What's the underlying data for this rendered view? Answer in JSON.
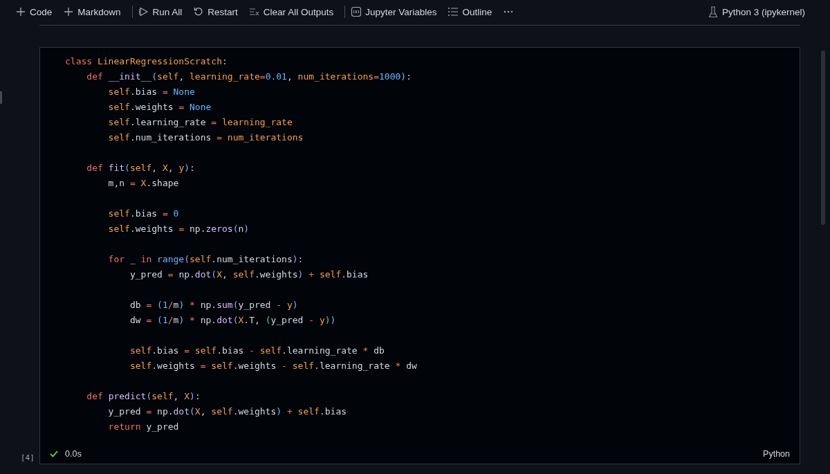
{
  "toolbar": {
    "items": [
      {
        "kind": "plus",
        "label": "Code"
      },
      {
        "kind": "plus",
        "label": "Markdown"
      },
      {
        "kind": "separator"
      },
      {
        "kind": "run",
        "label": "Run All"
      },
      {
        "kind": "restart",
        "label": "Restart"
      },
      {
        "kind": "clear",
        "label": "Clear All Outputs"
      },
      {
        "kind": "separator"
      },
      {
        "kind": "variables",
        "label": "Jupyter Variables"
      },
      {
        "kind": "outline",
        "label": "Outline"
      },
      {
        "kind": "more"
      }
    ],
    "kernel": {
      "label": "Python 3 (ipykernel)"
    }
  },
  "cell": {
    "execution_count": "[4]",
    "status": {
      "success": true,
      "duration": "0.0s"
    },
    "language": "Python",
    "lines": [
      {
        "tokens": [
          {
            "kind": "kw",
            "text": "class "
          },
          {
            "kind": "cls",
            "text": "LinearRegressionScratch"
          },
          {
            "kind": "plain",
            "text": ":"
          }
        ]
      },
      {
        "tokens": [
          {
            "kind": "kw",
            "text": "    def "
          },
          {
            "kind": "fn",
            "text": "__init__"
          },
          {
            "kind": "paren",
            "text": "("
          },
          {
            "kind": "self",
            "text": "self"
          },
          {
            "kind": "plain",
            "text": ", "
          },
          {
            "kind": "param",
            "text": "learning_rate"
          },
          {
            "kind": "op",
            "text": "="
          },
          {
            "kind": "num",
            "text": "0.01"
          },
          {
            "kind": "plain",
            "text": ", "
          },
          {
            "kind": "param",
            "text": "num_iterations"
          },
          {
            "kind": "op",
            "text": "="
          },
          {
            "kind": "num",
            "text": "1000"
          },
          {
            "kind": "paren",
            "text": ")"
          },
          {
            "kind": "plain",
            "text": ":"
          }
        ]
      },
      {
        "tokens": [
          {
            "kind": "self",
            "text": "        self"
          },
          {
            "kind": "plain",
            "text": ".bias "
          },
          {
            "kind": "op",
            "text": "= "
          },
          {
            "kind": "num",
            "text": "None"
          }
        ]
      },
      {
        "tokens": [
          {
            "kind": "self",
            "text": "        self"
          },
          {
            "kind": "plain",
            "text": ".weights "
          },
          {
            "kind": "op",
            "text": "= "
          },
          {
            "kind": "num",
            "text": "None"
          }
        ]
      },
      {
        "tokens": [
          {
            "kind": "self",
            "text": "        self"
          },
          {
            "kind": "plain",
            "text": ".learning_rate "
          },
          {
            "kind": "op",
            "text": "= "
          },
          {
            "kind": "param",
            "text": "learning_rate"
          }
        ]
      },
      {
        "tokens": [
          {
            "kind": "self",
            "text": "        self"
          },
          {
            "kind": "plain",
            "text": ".num_iterations "
          },
          {
            "kind": "op",
            "text": "= "
          },
          {
            "kind": "param",
            "text": "num_iterations"
          }
        ]
      },
      {
        "kind": "blank"
      },
      {
        "tokens": [
          {
            "kind": "kw",
            "text": "    def "
          },
          {
            "kind": "fn",
            "text": "fit"
          },
          {
            "kind": "paren",
            "text": "("
          },
          {
            "kind": "self",
            "text": "self"
          },
          {
            "kind": "plain",
            "text": ", "
          },
          {
            "kind": "param",
            "text": "X"
          },
          {
            "kind": "plain",
            "text": ", "
          },
          {
            "kind": "param",
            "text": "y"
          },
          {
            "kind": "paren",
            "text": ")"
          },
          {
            "kind": "plain",
            "text": ":"
          }
        ]
      },
      {
        "tokens": [
          {
            "kind": "plain",
            "text": "        m,n "
          },
          {
            "kind": "op",
            "text": "= "
          },
          {
            "kind": "param",
            "text": "X"
          },
          {
            "kind": "plain",
            "text": ".shape"
          }
        ]
      },
      {
        "kind": "blank"
      },
      {
        "tokens": [
          {
            "kind": "self",
            "text": "        self"
          },
          {
            "kind": "plain",
            "text": ".bias "
          },
          {
            "kind": "op",
            "text": "= "
          },
          {
            "kind": "num",
            "text": "0"
          }
        ]
      },
      {
        "tokens": [
          {
            "kind": "self",
            "text": "        self"
          },
          {
            "kind": "plain",
            "text": ".weights "
          },
          {
            "kind": "op",
            "text": "= "
          },
          {
            "kind": "plain",
            "text": "np."
          },
          {
            "kind": "fn",
            "text": "zeros"
          },
          {
            "kind": "paren",
            "text": "("
          },
          {
            "kind": "plain",
            "text": "n"
          },
          {
            "kind": "paren",
            "text": ")"
          }
        ]
      },
      {
        "kind": "blank"
      },
      {
        "tokens": [
          {
            "kind": "kw",
            "text": "        for "
          },
          {
            "kind": "plain",
            "text": "_ "
          },
          {
            "kind": "kw",
            "text": "in "
          },
          {
            "kind": "builtin",
            "text": "range"
          },
          {
            "kind": "paren",
            "text": "("
          },
          {
            "kind": "self",
            "text": "self"
          },
          {
            "kind": "plain",
            "text": ".num_iterations"
          },
          {
            "kind": "paren",
            "text": ")"
          },
          {
            "kind": "plain",
            "text": ":"
          }
        ]
      },
      {
        "tokens": [
          {
            "kind": "plain",
            "text": "            y_pred "
          },
          {
            "kind": "op",
            "text": "= "
          },
          {
            "kind": "plain",
            "text": "np."
          },
          {
            "kind": "fn",
            "text": "dot"
          },
          {
            "kind": "paren",
            "text": "("
          },
          {
            "kind": "param",
            "text": "X"
          },
          {
            "kind": "plain",
            "text": ", "
          },
          {
            "kind": "self",
            "text": "self"
          },
          {
            "kind": "plain",
            "text": ".weights"
          },
          {
            "kind": "paren",
            "text": ") "
          },
          {
            "kind": "op",
            "text": "+ "
          },
          {
            "kind": "self",
            "text": "self"
          },
          {
            "kind": "plain",
            "text": ".bias"
          }
        ]
      },
      {
        "kind": "blank"
      },
      {
        "tokens": [
          {
            "kind": "plain",
            "text": "            db "
          },
          {
            "kind": "op",
            "text": "= "
          },
          {
            "kind": "paren",
            "text": "("
          },
          {
            "kind": "num",
            "text": "1"
          },
          {
            "kind": "op",
            "text": "/"
          },
          {
            "kind": "plain",
            "text": "m"
          },
          {
            "kind": "paren",
            "text": ") "
          },
          {
            "kind": "op",
            "text": "* "
          },
          {
            "kind": "plain",
            "text": "np."
          },
          {
            "kind": "fn",
            "text": "sum"
          },
          {
            "kind": "paren",
            "text": "("
          },
          {
            "kind": "plain",
            "text": "y_pred "
          },
          {
            "kind": "op",
            "text": "- "
          },
          {
            "kind": "param",
            "text": "y"
          },
          {
            "kind": "paren",
            "text": ")"
          }
        ]
      },
      {
        "tokens": [
          {
            "kind": "plain",
            "text": "            dw "
          },
          {
            "kind": "op",
            "text": "= "
          },
          {
            "kind": "paren",
            "text": "("
          },
          {
            "kind": "num",
            "text": "1"
          },
          {
            "kind": "op",
            "text": "/"
          },
          {
            "kind": "plain",
            "text": "m"
          },
          {
            "kind": "paren",
            "text": ") "
          },
          {
            "kind": "op",
            "text": "* "
          },
          {
            "kind": "plain",
            "text": "np."
          },
          {
            "kind": "fn",
            "text": "dot"
          },
          {
            "kind": "paren",
            "text": "("
          },
          {
            "kind": "param",
            "text": "X"
          },
          {
            "kind": "plain",
            "text": ".T, "
          },
          {
            "kind": "paren2",
            "text": "("
          },
          {
            "kind": "plain",
            "text": "y_pred "
          },
          {
            "kind": "op",
            "text": "- "
          },
          {
            "kind": "param",
            "text": "y"
          },
          {
            "kind": "paren2",
            "text": ")"
          },
          {
            "kind": "paren",
            "text": ")"
          }
        ]
      },
      {
        "kind": "blank"
      },
      {
        "tokens": [
          {
            "kind": "self",
            "text": "            self"
          },
          {
            "kind": "plain",
            "text": ".bias "
          },
          {
            "kind": "op",
            "text": "= "
          },
          {
            "kind": "self",
            "text": "self"
          },
          {
            "kind": "plain",
            "text": ".bias "
          },
          {
            "kind": "op",
            "text": "- "
          },
          {
            "kind": "self",
            "text": "self"
          },
          {
            "kind": "plain",
            "text": ".learning_rate "
          },
          {
            "kind": "op",
            "text": "* "
          },
          {
            "kind": "plain",
            "text": "db"
          }
        ]
      },
      {
        "tokens": [
          {
            "kind": "self",
            "text": "            self"
          },
          {
            "kind": "plain",
            "text": ".weights "
          },
          {
            "kind": "op",
            "text": "= "
          },
          {
            "kind": "self",
            "text": "self"
          },
          {
            "kind": "plain",
            "text": ".weights "
          },
          {
            "kind": "op",
            "text": "- "
          },
          {
            "kind": "self",
            "text": "self"
          },
          {
            "kind": "plain",
            "text": ".learning_rate "
          },
          {
            "kind": "op",
            "text": "* "
          },
          {
            "kind": "plain",
            "text": "dw"
          }
        ]
      },
      {
        "kind": "blank"
      },
      {
        "tokens": [
          {
            "kind": "kw",
            "text": "    def "
          },
          {
            "kind": "fn",
            "text": "predict"
          },
          {
            "kind": "paren",
            "text": "("
          },
          {
            "kind": "self",
            "text": "self"
          },
          {
            "kind": "plain",
            "text": ", "
          },
          {
            "kind": "param",
            "text": "X"
          },
          {
            "kind": "paren",
            "text": ")"
          },
          {
            "kind": "plain",
            "text": ":"
          }
        ]
      },
      {
        "tokens": [
          {
            "kind": "plain",
            "text": "        y_pred "
          },
          {
            "kind": "op",
            "text": "= "
          },
          {
            "kind": "plain",
            "text": "np."
          },
          {
            "kind": "fn",
            "text": "dot"
          },
          {
            "kind": "paren",
            "text": "("
          },
          {
            "kind": "param",
            "text": "X"
          },
          {
            "kind": "plain",
            "text": ", "
          },
          {
            "kind": "self",
            "text": "self"
          },
          {
            "kind": "plain",
            "text": ".weights"
          },
          {
            "kind": "paren",
            "text": ") "
          },
          {
            "kind": "op",
            "text": "+ "
          },
          {
            "kind": "self",
            "text": "self"
          },
          {
            "kind": "plain",
            "text": ".bias"
          }
        ]
      },
      {
        "tokens": [
          {
            "kind": "kw",
            "text": "        return "
          },
          {
            "kind": "plain",
            "text": "y_pred"
          }
        ]
      }
    ]
  }
}
